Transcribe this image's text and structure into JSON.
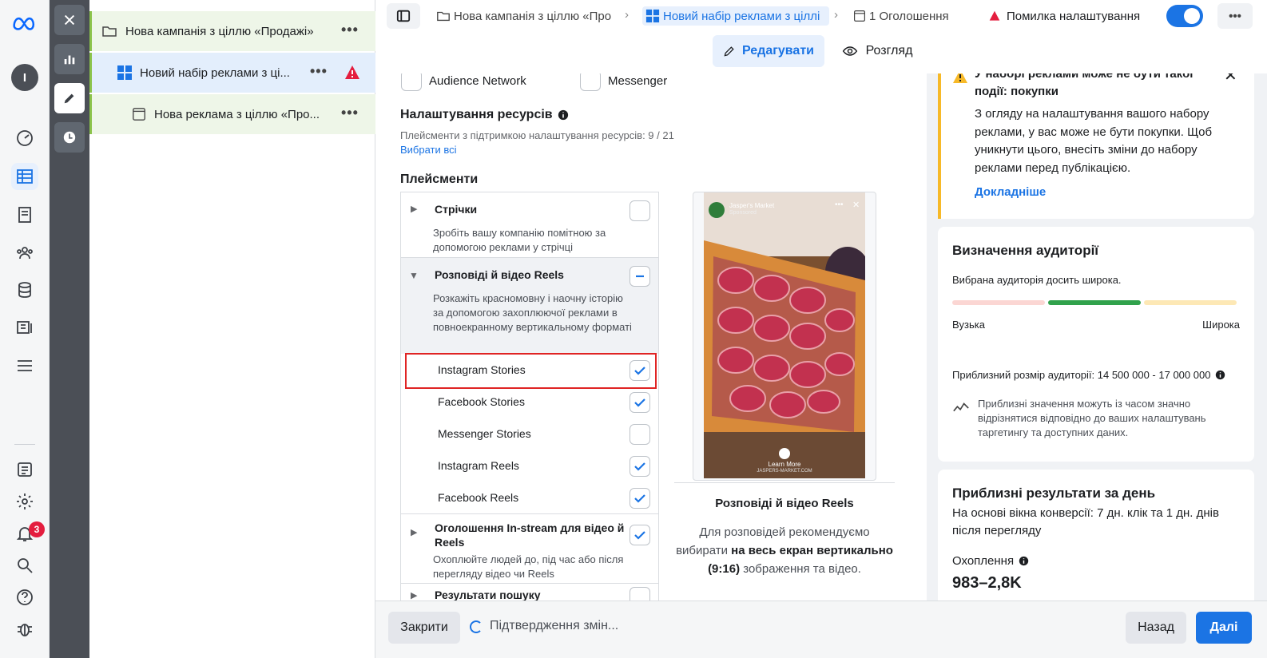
{
  "tree": {
    "campaign": "Нова кампанія з ціллю «Продажі»",
    "adset": "Новий набір реклами з ці...",
    "ad": "Нова реклама з ціллю «Про..."
  },
  "rail": {
    "notification_count": "3",
    "avatar_letter": "I"
  },
  "topbar": {
    "crumb_campaign": "Нова кампанія з ціллю «Про",
    "crumb_adset": "Новий набір реклами з ціллі",
    "crumb_ads": "1 Оголошення",
    "error_label": "Помилка налаштування"
  },
  "subbar": {
    "edit_label": "Редагувати",
    "preview_label": "Розгляд"
  },
  "form": {
    "top_options": [
      "Audience Network",
      "Messenger"
    ],
    "resource_title": "Налаштування ресурсів",
    "resource_count": "Плейсменти з підтримкою налаштування ресурсів: 9 / 21",
    "select_all": "Вибрати всі",
    "placements_title": "Плейсменти",
    "feeds_title": "Стрічки",
    "feeds_desc": "Зробіть вашу компанію помітною за допомогою реклами у стрічці",
    "stories_title": "Розповіді й відео Reels",
    "stories_desc": "Розкажіть красномовну і наочну історію за допомогою захоплюючої реклами в повноекранному вертикальному форматі",
    "items": [
      {
        "label": "Instagram Stories",
        "checked": true
      },
      {
        "label": "Facebook Stories",
        "checked": true
      },
      {
        "label": "Messenger Stories",
        "checked": false
      },
      {
        "label": "Instagram Reels",
        "checked": true
      },
      {
        "label": "Facebook Reels",
        "checked": true
      }
    ],
    "instream_title": "Оголошення In-stream для відео й Reels",
    "instream_desc": "Охоплюйте людей до, під час або після перегляду відео чи Reels",
    "next_cut": "Результати пошуку"
  },
  "preview": {
    "brand": "Jasper's Market",
    "sponsored": "Sponsored",
    "learn_more": "Learn More",
    "url": "JASPERS-MARKET.COM",
    "title": "Розповіді й відео Reels",
    "desc_1": "Для розповідей рекомендуємо вибирати ",
    "desc_bold": "на весь екран вертикально (9:16)",
    "desc_2": " зображення та відео."
  },
  "warning": {
    "title": "У наборі реклами може не бути такої події: покупки",
    "body": "З огляду на налаштування вашого набору реклами, у вас може не бути покупки. Щоб уникнути цього, внесіть зміни до набору реклами перед публікацією.",
    "link": "Докладніше"
  },
  "audience": {
    "title": "Визначення аудиторії",
    "status": "Вибрана аудиторія досить широка.",
    "narrow": "Вузька",
    "wide": "Широка",
    "level": 0.5,
    "size": "Приблизний розмір аудиторії: 14 500 000 - 17 000 000",
    "note": "Приблизні значення можуть із часом значно відрізнятися відповідно до ваших налаштувань таргетингу та доступних даних."
  },
  "results": {
    "title": "Приблизні результати за день",
    "basis": "На основі вікна конверсії: 7 дн. клік та 1 дн. днів після перегляду",
    "reach_label": "Охоплення",
    "reach_value": "983–2,8K"
  },
  "bottom": {
    "close": "Закрити",
    "status": "Підтвердження змін...",
    "back": "Назад",
    "next": "Далі"
  },
  "colors": {
    "accent": "#1b74e4",
    "warning": "#f7b928",
    "error": "#e41e3f",
    "good": "#31a24c"
  }
}
